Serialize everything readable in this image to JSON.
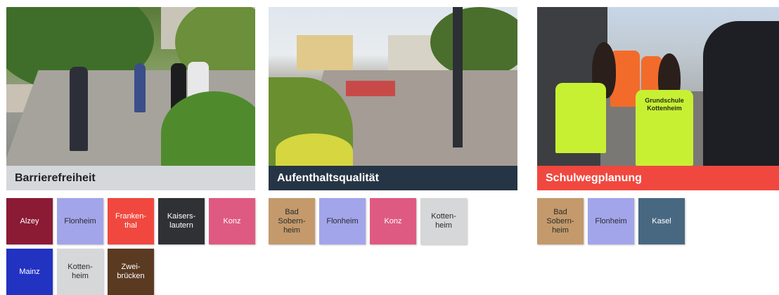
{
  "columns": [
    {
      "caption": "Barrierefreiheit",
      "tiles": [
        {
          "label": "Alzey",
          "bg": "#8b1a35",
          "fg": "#ffffff"
        },
        {
          "label": "Flonheim",
          "bg": "#a3a5ea",
          "fg": "#2b2b33"
        },
        {
          "label": "Franken-\nthal",
          "bg": "#f0483f",
          "fg": "#ffffff"
        },
        {
          "label": "Kaisers-\nlautern",
          "bg": "#2f3135",
          "fg": "#ffffff"
        },
        {
          "label": "Konz",
          "bg": "#df5a82",
          "fg": "#ffffff"
        },
        {
          "label": "Mainz",
          "bg": "#2233c2",
          "fg": "#ffffff"
        },
        {
          "label": "Kotten-\nheim",
          "bg": "#d6d7d8",
          "fg": "#2b2b2b"
        },
        {
          "label": "Zwei-\nbrücken",
          "bg": "#5b3a22",
          "fg": "#ffffff"
        }
      ]
    },
    {
      "caption": "Aufenthaltsqualität",
      "tiles": [
        {
          "label": "Bad\nSobern-\nheim",
          "bg": "#c49a6c",
          "fg": "#2b2b2b"
        },
        {
          "label": "Flonheim",
          "bg": "#a3a5ea",
          "fg": "#2b2b33"
        },
        {
          "label": "Konz",
          "bg": "#df5a82",
          "fg": "#ffffff"
        },
        {
          "label": "Kotten-\nheim",
          "bg": "#d6d7d8",
          "fg": "#2b2b2b"
        }
      ]
    },
    {
      "caption": "Schulwegplanung",
      "tiles": [
        {
          "label": "Bad\nSobern-\nheim",
          "bg": "#c49a6c",
          "fg": "#2b2b2b"
        },
        {
          "label": "Flonheim",
          "bg": "#a3a5ea",
          "fg": "#2b2b33"
        },
        {
          "label": "Kasel",
          "bg": "#486882",
          "fg": "#ffffff"
        }
      ]
    }
  ],
  "caption_styles": [
    {
      "bg": "#d5d8db",
      "fg": "#222222"
    },
    {
      "bg": "#263545",
      "fg": "#ffffff"
    },
    {
      "bg": "#f0483f",
      "fg": "#ffffff"
    }
  ],
  "vest_text": "Grundschule\nKottenheim"
}
